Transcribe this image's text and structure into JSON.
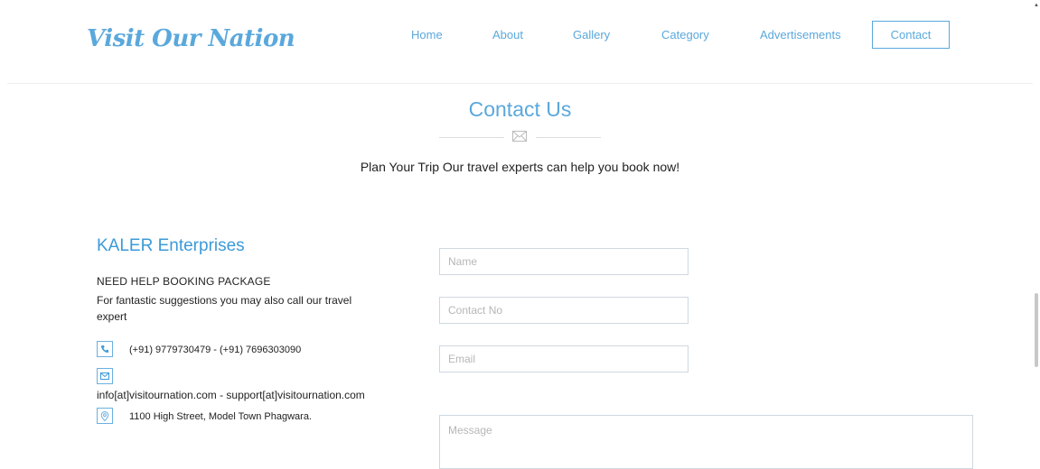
{
  "header": {
    "logo": "Visit Our Nation",
    "nav": [
      {
        "label": "Home"
      },
      {
        "label": "About"
      },
      {
        "label": "Gallery"
      },
      {
        "label": "Category"
      },
      {
        "label": "Advertisements"
      },
      {
        "label": "Contact"
      }
    ]
  },
  "section": {
    "title": "Contact Us",
    "tagline": "Plan Your Trip Our travel experts can help you book now!"
  },
  "info": {
    "company": "KALER Enterprises",
    "heading": "NEED HELP BOOKING PACKAGE",
    "text": "For fantastic suggestions you may also call our travel expert",
    "phones": "(+91) 9779730479   -   (+91) 7696303090",
    "emails": "info[at]visitournation.com   -   support[at]visitournation.com",
    "address": "1100 High Street, Model Town Phagwara."
  },
  "form": {
    "name_placeholder": "Name",
    "contact_placeholder": "Contact No",
    "email_placeholder": "Email",
    "message_placeholder": "Message"
  },
  "colors": {
    "accent": "#5aa8dc",
    "company": "#3c9ad8",
    "field_border": "#cfd8e0"
  },
  "icons": [
    "phone-icon",
    "envelope-icon",
    "map-pin-icon"
  ]
}
